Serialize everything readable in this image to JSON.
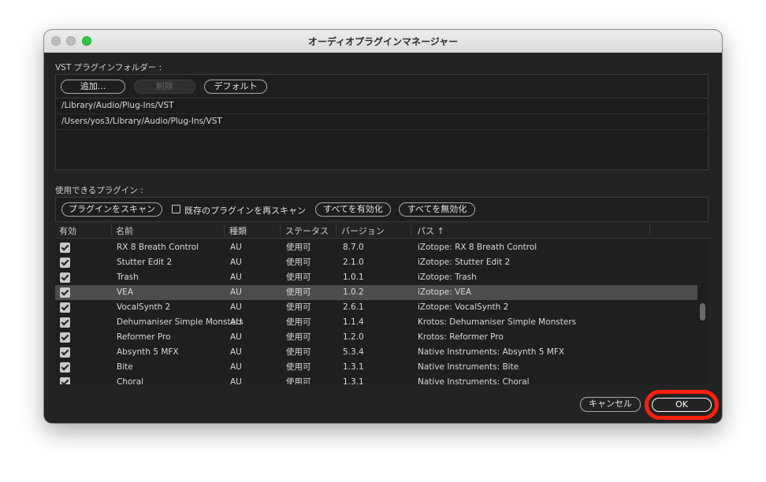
{
  "window": {
    "title": "オーディオプラグインマネージャー"
  },
  "vst_folders": {
    "label": "VST プラグインフォルダー :",
    "add_label": "追加...",
    "remove_label": "削除",
    "default_label": "デフォルト",
    "paths": [
      "/Library/Audio/Plug-Ins/VST",
      "/Users/yos3/Library/Audio/Plug-Ins/VST"
    ]
  },
  "plugins": {
    "label": "使用できるプラグイン :",
    "scan_label": "プラグインをスキャン",
    "rescan_label": "既存のプラグインを再スキャン",
    "enable_all_label": "すべてを有効化",
    "disable_all_label": "すべてを無効化",
    "columns": [
      "有効",
      "名前",
      "種類",
      "ステータス",
      "バージョン",
      "パス"
    ],
    "sort_arrow": "↑",
    "rows": [
      {
        "name": "RX 8 Breath Control",
        "type": "AU",
        "status": "使用可",
        "version": "8.7.0",
        "path": "iZotope: RX 8 Breath Control"
      },
      {
        "name": "Stutter Edit 2",
        "type": "AU",
        "status": "使用可",
        "version": "2.1.0",
        "path": "iZotope: Stutter Edit 2"
      },
      {
        "name": "Trash",
        "type": "AU",
        "status": "使用可",
        "version": "1.0.1",
        "path": "iZotope: Trash"
      },
      {
        "name": "VEA",
        "type": "AU",
        "status": "使用可",
        "version": "1.0.2",
        "path": "iZotope: VEA"
      },
      {
        "name": "VocalSynth 2",
        "type": "AU",
        "status": "使用可",
        "version": "2.6.1",
        "path": "iZotope: VocalSynth 2"
      },
      {
        "name": "Dehumaniser Simple Monsters",
        "type": "AU",
        "status": "使用可",
        "version": "1.1.4",
        "path": "Krotos: Dehumaniser Simple Monsters"
      },
      {
        "name": "Reformer Pro",
        "type": "AU",
        "status": "使用可",
        "version": "1.2.0",
        "path": "Krotos: Reformer Pro"
      },
      {
        "name": "Absynth 5 MFX",
        "type": "AU",
        "status": "使用可",
        "version": "5.3.4",
        "path": "Native Instruments: Absynth 5 MFX"
      },
      {
        "name": "Bite",
        "type": "AU",
        "status": "使用可",
        "version": "1.3.1",
        "path": "Native Instruments: Bite"
      },
      {
        "name": "Choral",
        "type": "AU",
        "status": "使用可",
        "version": "1.3.1",
        "path": "Native Instruments: Choral"
      }
    ],
    "selected_index": 3
  },
  "footer": {
    "cancel_label": "キャンセル",
    "ok_label": "OK"
  },
  "colors": {
    "highlight_ring": "#ff1f0f",
    "selected_row": "#4c4c4c"
  }
}
